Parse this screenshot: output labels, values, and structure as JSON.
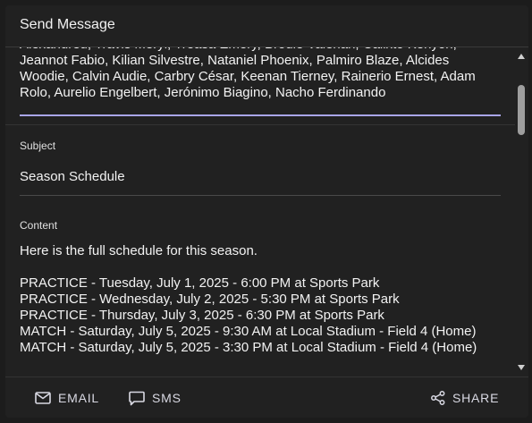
{
  "dialog": {
    "title": "Send Message"
  },
  "recipients": {
    "text": "Alexandreu, Travis Meryl, Treasa Emery, Brodie Valerian, Calixto Kenyon, Jeannot Fabio, Kilian Silvestre, Nataniel Phoenix, Palmiro Blaze, Alcides Woodie, Calvin Audie, Carbry César, Keenan Tierney, Rainerio Ernest, Adam Rolo, Aurelio Engelbert, Jerónimo Biagino, Nacho Ferdinando"
  },
  "subject": {
    "label": "Subject",
    "value": "Season Schedule"
  },
  "content": {
    "label": "Content",
    "value": "Here is the full schedule for this season.\n\nPRACTICE - Tuesday, July 1, 2025 - 6:00 PM at Sports Park\nPRACTICE - Wednesday, July 2, 2025 - 5:30 PM at Sports Park\nPRACTICE - Thursday, July 3, 2025 - 6:30 PM at Sports Park\nMATCH - Saturday, July 5, 2025 - 9:30 AM at Local Stadium - Field 4 (Home)\nMATCH - Saturday, July 5, 2025 - 3:30 PM at Local Stadium - Field 4 (Home)"
  },
  "footer": {
    "email_label": "EMAIL",
    "sms_label": "SMS",
    "share_label": "SHARE"
  },
  "icons": {
    "email": "mail-icon",
    "sms": "chat-bubble-icon",
    "share": "share-icon"
  },
  "colors": {
    "background": "#212121",
    "accent_underline": "#a9a6e8",
    "text": "#f2f2f2",
    "button_text": "#d9d9e3"
  }
}
